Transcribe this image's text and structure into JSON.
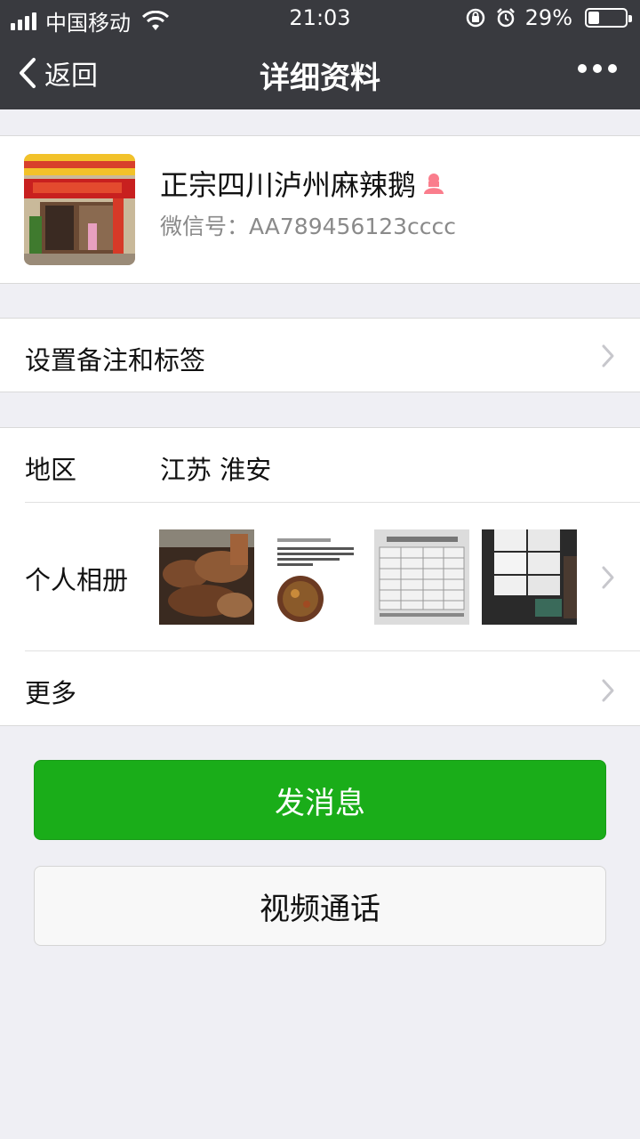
{
  "status_bar": {
    "carrier": "中国移动",
    "time": "21:03",
    "battery": "29%",
    "battery_level": 0.29
  },
  "nav": {
    "back_label": "返回",
    "title": "详细资料"
  },
  "profile": {
    "name": "正宗四川泸州麻辣鹅",
    "wechat_id": "微信号：AA789456123cccc",
    "gender_icon": "female-icon",
    "gender_color": "#fa7d8c"
  },
  "remark": {
    "label": "设置备注和标签"
  },
  "info": {
    "region_label": "地区",
    "region_value": "江苏 淮安",
    "album_label": "个人相册",
    "more_label": "更多"
  },
  "buttons": {
    "send_message": "发消息",
    "video_call": "视频通话"
  },
  "colors": {
    "header_bg": "#393a3f",
    "primary_green": "#1aad19",
    "page_bg": "#efeff4"
  }
}
